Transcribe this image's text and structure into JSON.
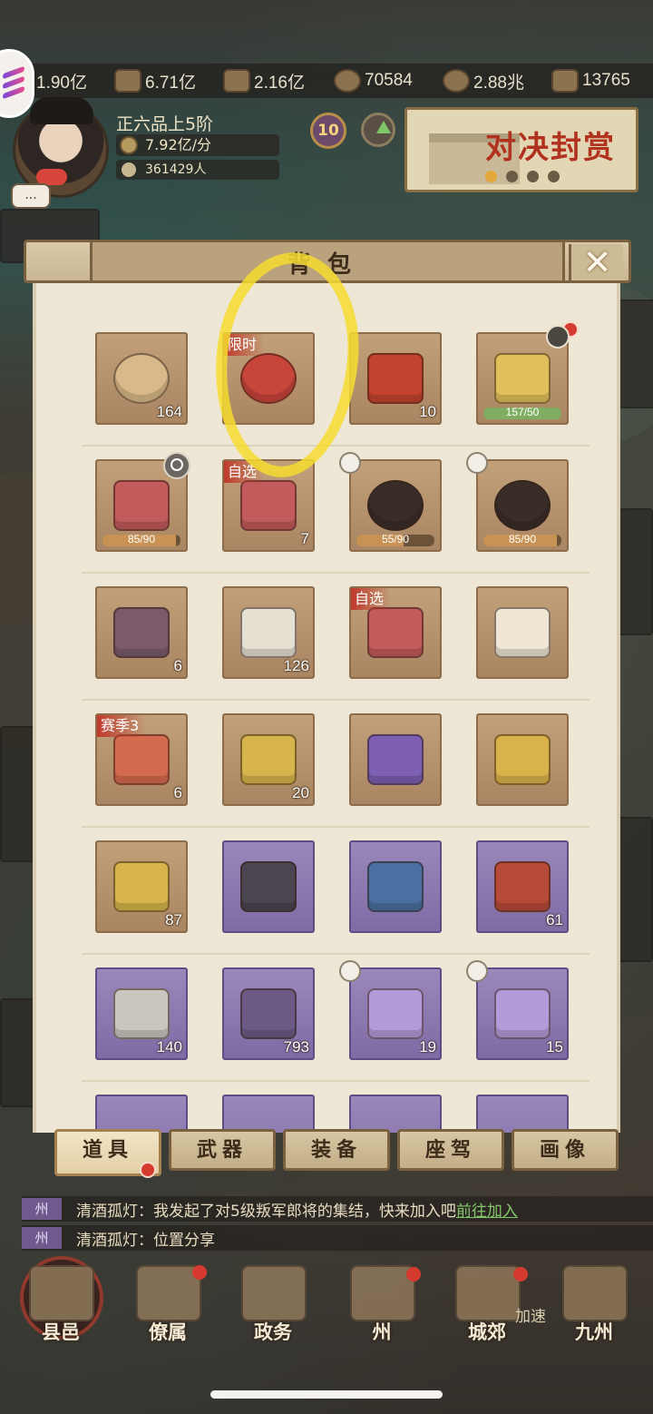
{
  "top_bar": {
    "resources": [
      {
        "icon": "grain-icon",
        "value": "1.90亿"
      },
      {
        "icon": "wood-icon",
        "value": "6.71亿"
      },
      {
        "icon": "stone-icon",
        "value": "2.16亿"
      },
      {
        "icon": "copper-coin-icon",
        "value": "70584"
      },
      {
        "icon": "silver-coin-icon",
        "value": "2.88兆"
      },
      {
        "icon": "ingot-icon",
        "value": "13765"
      }
    ]
  },
  "player": {
    "rank": "正六品上5阶",
    "income": "7.92亿/分",
    "population": "361429人",
    "chat_bubble": "...",
    "level": "10"
  },
  "banner": {
    "title": "对决封赏"
  },
  "panel": {
    "title": "背包",
    "close_symbol": "✕"
  },
  "items": [
    {
      "tag": "",
      "qty": "164",
      "variant": "brown",
      "icon": "scroll-portrait-icon"
    },
    {
      "tag": "限时",
      "qty": "",
      "variant": "brown",
      "icon": "meat-dish-icon"
    },
    {
      "tag": "",
      "qty": "10",
      "variant": "brown",
      "icon": "red-brick-icon"
    },
    {
      "tag": "",
      "qty": "",
      "variant": "brown",
      "icon": "gold-token-icon",
      "progress": "157/50",
      "progress_frac": 1.0,
      "progress_color": "green"
    },
    {
      "tag": "",
      "qty": "",
      "variant": "brown",
      "icon": "treasure-chest-icon",
      "progress": "85/90",
      "progress_frac": 0.94
    },
    {
      "tag": "自选",
      "qty": "7",
      "variant": "brown",
      "icon": "select-chest-icon"
    },
    {
      "tag": "",
      "qty": "",
      "variant": "brown",
      "icon": "hero-portrait-icon",
      "progress": "55/90",
      "progress_frac": 0.61
    },
    {
      "tag": "",
      "qty": "",
      "variant": "brown",
      "icon": "heroine-portrait-icon",
      "progress": "85/90",
      "progress_frac": 0.94
    },
    {
      "tag": "",
      "qty": "6",
      "variant": "brown",
      "icon": "book-icon"
    },
    {
      "tag": "",
      "qty": "126",
      "variant": "brown",
      "icon": "hammer-scroll-icon"
    },
    {
      "tag": "自选",
      "qty": "",
      "variant": "brown",
      "icon": "select-chest-icon"
    },
    {
      "tag": "",
      "qty": "",
      "variant": "brown",
      "icon": "duel-letter-icon"
    },
    {
      "tag": "赛季3",
      "qty": "6",
      "variant": "brown",
      "icon": "season-pendant-icon"
    },
    {
      "tag": "",
      "qty": "20",
      "variant": "brown",
      "icon": "gold-pendant-icon"
    },
    {
      "tag": "",
      "qty": "",
      "variant": "brown",
      "icon": "purple-cloth-icon"
    },
    {
      "tag": "",
      "qty": "",
      "variant": "brown",
      "icon": "gold-ore-icon"
    },
    {
      "tag": "",
      "qty": "87",
      "variant": "brown",
      "icon": "gold-banner-icon"
    },
    {
      "tag": "",
      "qty": "",
      "variant": "purple",
      "icon": "axe-upgrade-icon"
    },
    {
      "tag": "",
      "qty": "",
      "variant": "purple",
      "icon": "blue-tablet-icon"
    },
    {
      "tag": "",
      "qty": "61",
      "variant": "purple",
      "icon": "hammer-wheel-icon"
    },
    {
      "tag": "",
      "qty": "140",
      "variant": "purple",
      "icon": "horseshoe-icon"
    },
    {
      "tag": "",
      "qty": "793",
      "variant": "purple",
      "icon": "crystal-icon"
    },
    {
      "tag": "",
      "qty": "19",
      "variant": "purple",
      "icon": "purple-scroll-icon"
    },
    {
      "tag": "",
      "qty": "15",
      "variant": "purple",
      "icon": "purple-scroll-icon"
    }
  ],
  "tabs": [
    {
      "label": "道具",
      "active": true
    },
    {
      "label": "武器",
      "active": false
    },
    {
      "label": "装备",
      "active": false
    },
    {
      "label": "座驾",
      "active": false
    },
    {
      "label": "画像",
      "active": false
    }
  ],
  "chat": [
    {
      "channel": "州",
      "text": "清酒孤灯：我发起了对5级叛军郎将的集结，快来加入吧",
      "link": "前往加入"
    },
    {
      "channel": "州",
      "text": "清酒孤灯：位置分享",
      "link": ""
    }
  ],
  "bottom_nav": [
    {
      "label": "县邑",
      "icon": "county-gate-icon"
    },
    {
      "label": "僚属",
      "icon": "officials-icon"
    },
    {
      "label": "政务",
      "icon": "affairs-icon"
    },
    {
      "label": "州",
      "icon": "state-icon"
    },
    {
      "label": "城郊",
      "icon": "suburb-icon"
    },
    {
      "label": "九州",
      "icon": "nine-states-icon"
    }
  ],
  "speed_label": "加速",
  "colors": {
    "highlight": "#f6dc30",
    "tag_red": "#c0392b",
    "link_green": "#83c56b"
  }
}
